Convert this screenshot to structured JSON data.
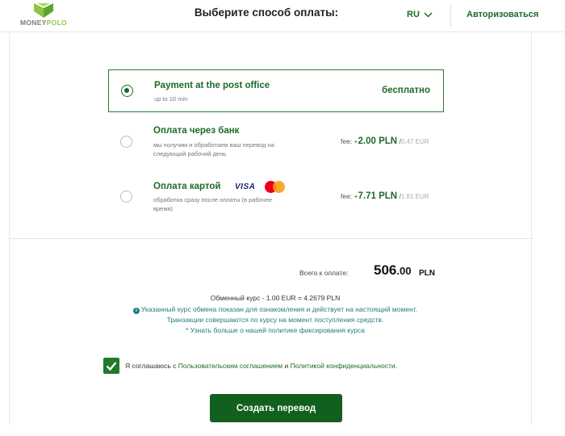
{
  "header": {
    "logo_money": "MONEY",
    "logo_polo": "POLO",
    "lang": "RU",
    "login": "Авторизоваться"
  },
  "title": "Выберите способ оплаты:",
  "options": [
    {
      "title": "Payment at the post office",
      "sub": "up to 10 min",
      "price": "бесплатно",
      "selected": true
    },
    {
      "title": "Оплата через банк",
      "sub1": "мы получим и обработаем ваш перевод на",
      "sub2": "следующий рабочий день",
      "fee_label": "fee: +",
      "fee_amount": "2.00 PLN",
      "fee_eur": "0.47 EUR",
      "selected": false
    },
    {
      "title": "Оплата картой",
      "card_visa": "VISA",
      "sub1": "обработка сразу после оплаты (в рабочее",
      "sub2": "время)",
      "fee_label": "fee: +",
      "fee_amount": "7.71 PLN",
      "fee_eur": "1.81 EUR",
      "selected": false
    }
  ],
  "total": {
    "label": "Всего к оплате:",
    "int": "506",
    "dec": ".00",
    "currency": "PLN"
  },
  "rate": "Обменный курс - 1.00 EUR = 4.2679 PLN",
  "info": {
    "line1": "Указанный курс обмена показан для ознакомления и действует на настоящий момент.",
    "line2": "Транзакции совершаются по курсу на момент поступления средств.",
    "line3": "* Узнать больше о нашей политике фиксирования курса"
  },
  "agree": {
    "prefix": "Я соглашаюсь с ",
    "link1": "Пользовательским соглашением",
    "and": " и ",
    "link2": "Политикой конфиденциальности",
    "suffix": ".",
    "checked": true
  },
  "create_button": "Создать перевод",
  "colors": {
    "brand_green": "#1c6b2a",
    "button_green": "#11601d",
    "info_teal": "#237c83",
    "logo_lime": "#8cc63f"
  }
}
